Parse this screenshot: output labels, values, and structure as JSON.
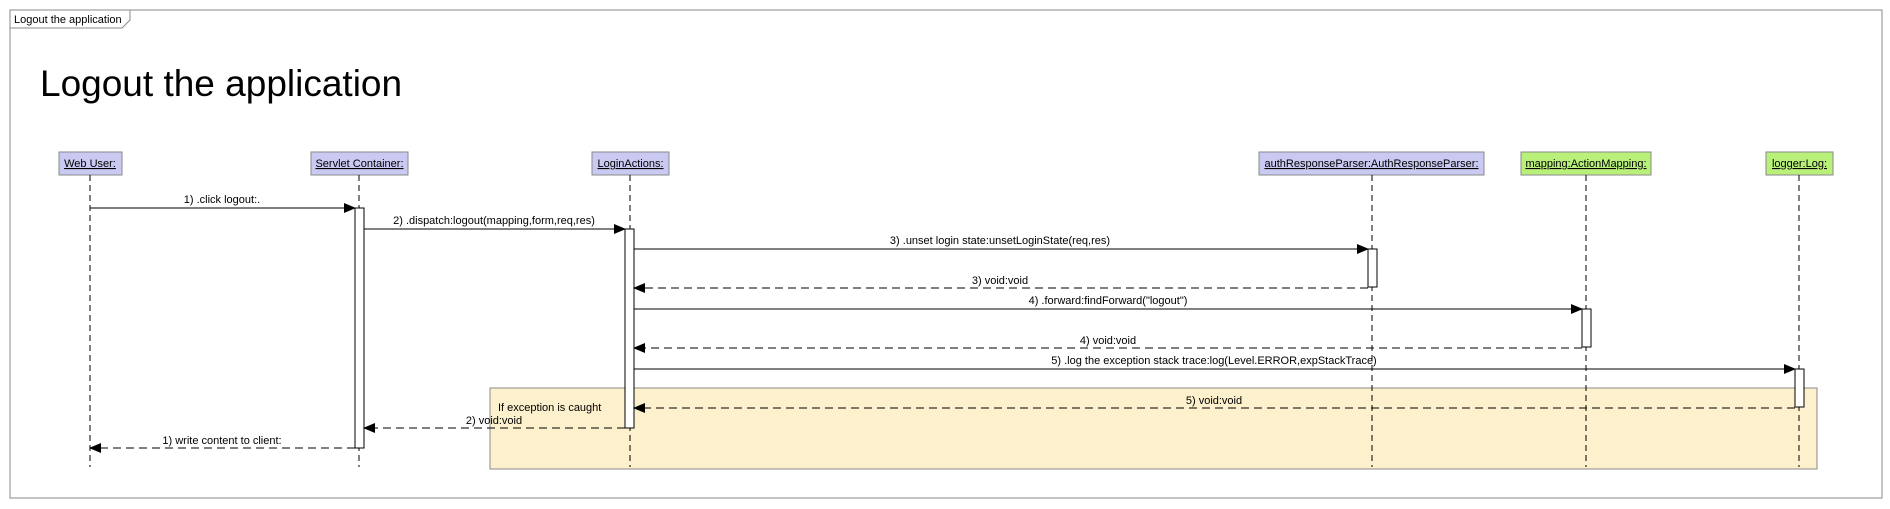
{
  "frame_tab": "Logout the application",
  "title": "Logout the application",
  "colors": {
    "actor_fill": "#c9c9f2",
    "actor_fill_alt": "#b8f07a",
    "note_fill": "#fdf0cc",
    "stroke": "#000000"
  },
  "lifelines": [
    {
      "id": "web-user",
      "label": "Web User:",
      "color": "actor_fill"
    },
    {
      "id": "servlet-container",
      "label": "Servlet Container:",
      "color": "actor_fill"
    },
    {
      "id": "login-actions",
      "label": "LoginActions:",
      "color": "actor_fill"
    },
    {
      "id": "auth-response-parser",
      "label": "authResponseParser:AuthResponseParser:",
      "color": "actor_fill"
    },
    {
      "id": "mapping",
      "label": "mapping:ActionMapping:",
      "color": "actor_fill_alt"
    },
    {
      "id": "logger",
      "label": "logger:Log:",
      "color": "actor_fill_alt"
    }
  ],
  "messages": [
    {
      "label": "1) .click logout:.",
      "kind": "call"
    },
    {
      "label": "2) .dispatch:logout(mapping,form,req,res)",
      "kind": "call"
    },
    {
      "label": "3) .unset login state:unsetLoginState(req,res)",
      "kind": "call"
    },
    {
      "label": "3) void:void",
      "kind": "return"
    },
    {
      "label": "4) .forward:findForward(\"logout\")",
      "kind": "call"
    },
    {
      "label": "4) void:void",
      "kind": "return"
    },
    {
      "label": "5) .log the exception stack trace:log(Level.ERROR,expStackTrace)",
      "kind": "call"
    },
    {
      "label": "5) void:void",
      "kind": "return"
    },
    {
      "label": "2) void:void",
      "kind": "return"
    },
    {
      "label": "1) write content to client:",
      "kind": "return"
    }
  ],
  "note": {
    "text": "If exception is caught"
  }
}
